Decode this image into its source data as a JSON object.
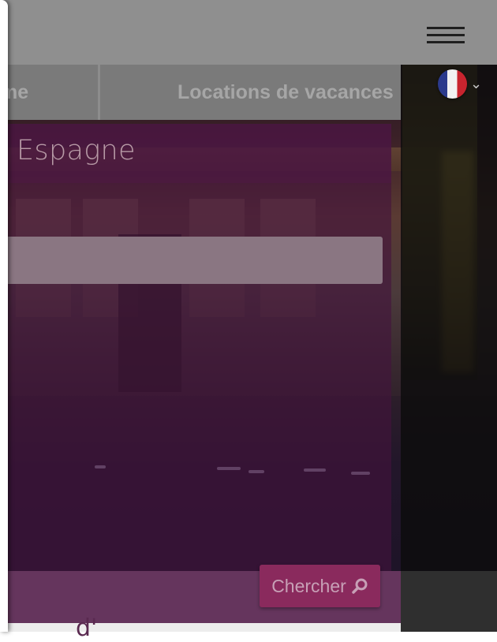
{
  "nav": {
    "items": [
      {
        "label": "me"
      },
      {
        "label": "Locations de vacances"
      }
    ]
  },
  "search_panel": {
    "title": "Espagne",
    "search_input": {
      "value": "",
      "placeholder": ""
    },
    "button_label": "Chercher"
  },
  "language": {
    "flag": "france-flag-icon"
  },
  "footer_partial_text": "d'",
  "colors": {
    "panel_overlay": "#44123e",
    "button_bg": "#8a2a5d",
    "header_bg": "#8f8f8f"
  }
}
